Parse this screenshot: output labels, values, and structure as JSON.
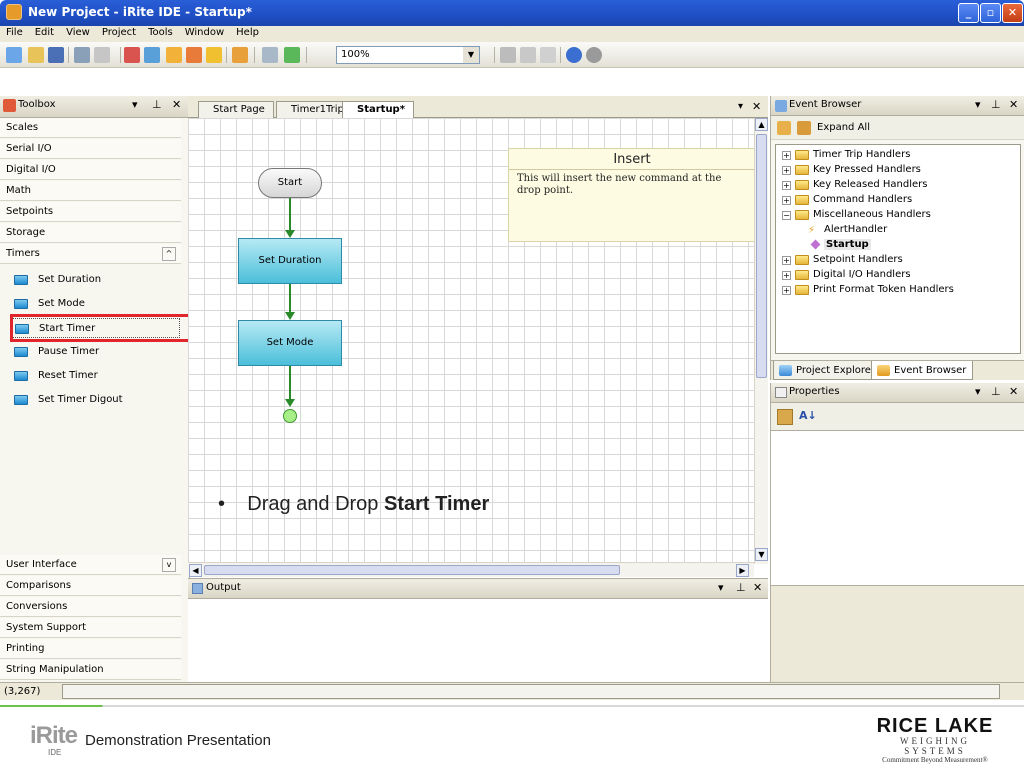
{
  "window": {
    "title": "New Project - iRite IDE - Startup*"
  },
  "menu": [
    "File",
    "Edit",
    "View",
    "Project",
    "Tools",
    "Window",
    "Help"
  ],
  "toolbar": {
    "zoom_value": "100%"
  },
  "toolbox": {
    "title": "Toolbox",
    "categories_top": [
      "Scales",
      "Serial I/O",
      "Digital I/O",
      "Math",
      "Setpoints",
      "Storage",
      "Timers"
    ],
    "timer_tools": [
      "Set Duration",
      "Set Mode",
      "Start Timer",
      "Pause Timer",
      "Reset Timer",
      "Set Timer Digout"
    ],
    "categories_bottom": [
      "User Interface",
      "Comparisons",
      "Conversions",
      "System Support",
      "Printing",
      "String Manipulation"
    ]
  },
  "tabs": [
    "Start Page",
    "Timer1Trip",
    "Startup*"
  ],
  "flowchart": {
    "start_label": "Start",
    "nodes": [
      "Set Duration",
      "Set Mode"
    ]
  },
  "tooltip": {
    "title": "Insert",
    "body": "This will insert the new command at the drop point."
  },
  "instruction": {
    "bullet": "•",
    "prefix": "Drag and Drop ",
    "bold": "Start Timer"
  },
  "output": {
    "title": "Output"
  },
  "event_browser": {
    "title": "Event Browser",
    "expand_all": "Expand All",
    "tree": [
      {
        "label": "Timer Trip Handlers",
        "level": 0,
        "expanded": false
      },
      {
        "label": "Key Pressed Handlers",
        "level": 0,
        "expanded": false
      },
      {
        "label": "Key Released Handlers",
        "level": 0,
        "expanded": false
      },
      {
        "label": "Command Handlers",
        "level": 0,
        "expanded": false
      },
      {
        "label": "Miscellaneous Handlers",
        "level": 0,
        "expanded": true
      },
      {
        "label": "AlertHandler",
        "level": 1
      },
      {
        "label": "Startup",
        "level": 1,
        "selected": true
      },
      {
        "label": "Setpoint Handlers",
        "level": 0,
        "expanded": false
      },
      {
        "label": "Digital I/O Handlers",
        "level": 0,
        "expanded": false
      },
      {
        "label": "Print Format Token Handlers",
        "level": 0,
        "expanded": false
      }
    ],
    "bottom_tabs": [
      "Project Explorer",
      "Event Browser"
    ]
  },
  "properties": {
    "title": "Properties"
  },
  "status": {
    "coords": "(3,267)"
  },
  "footer": {
    "logo_text": "iRite",
    "logo_sub": "IDE",
    "caption": "Demonstration Presentation",
    "brand_line1": "RICE LAKE",
    "brand_line2": "WEIGHING SYSTEMS",
    "brand_line3": "Commitment Beyond Measurement®"
  },
  "colors": {
    "highlight": "#e0262c",
    "node_fill": "#4bbfda",
    "connector": "#2a8a2a"
  }
}
